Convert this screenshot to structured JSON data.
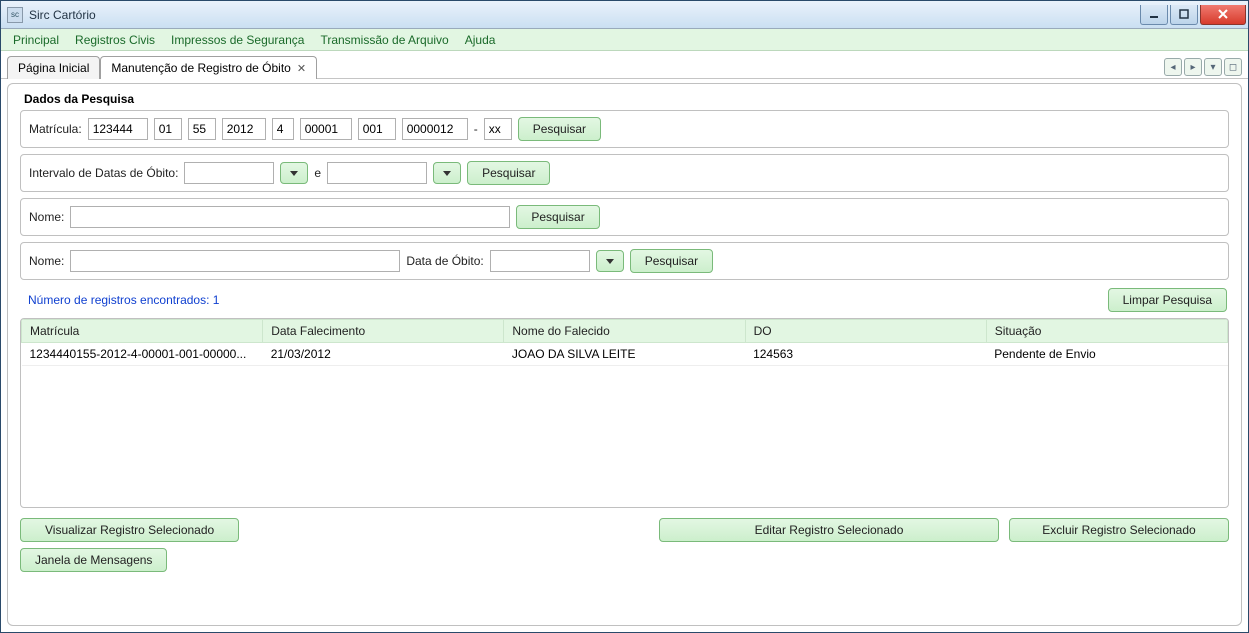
{
  "window": {
    "title": "Sirc Cartório"
  },
  "menu": {
    "principal": "Principal",
    "registros": "Registros Civis",
    "impressos": "Impressos de Segurança",
    "transmissao": "Transmissão de Arquivo",
    "ajuda": "Ajuda"
  },
  "tabs": {
    "inicio": "Página Inicial",
    "manutencao": "Manutenção de Registro de Óbito"
  },
  "search": {
    "panel_title": "Dados da Pesquisa",
    "matricula_label": "Matrícula:",
    "matricula_parts": {
      "p1": "123444",
      "p2": "01",
      "p3": "55",
      "p4": "2012",
      "p5": "4",
      "p6": "00001",
      "p7": "001",
      "p8": "0000012",
      "dash": "-",
      "dv": "xx"
    },
    "pesquisar": "Pesquisar",
    "intervalo_label": "Intervalo de Datas de Óbito:",
    "e": "e",
    "nome_label": "Nome:",
    "data_obito_label": "Data de Óbito:",
    "found_text": "Número de registros encontrados: 1",
    "limpar": "Limpar Pesquisa"
  },
  "grid": {
    "headers": {
      "matricula": "Matrícula",
      "data_falec": "Data Falecimento",
      "nome_falec": "Nome do Falecido",
      "do": "DO",
      "situacao": "Situação"
    },
    "rows": [
      {
        "matricula": "1234440155-2012-4-00001-001-00000...",
        "data_falec": "21/03/2012",
        "nome_falec": "JOAO DA SILVA LEITE",
        "do": "124563",
        "situacao": "Pendente de Envio"
      }
    ]
  },
  "actions": {
    "visualizar": "Visualizar Registro Selecionado",
    "editar": "Editar Registro Selecionado",
    "excluir": "Excluir Registro Selecionado",
    "janela_msg": "Janela de Mensagens"
  }
}
